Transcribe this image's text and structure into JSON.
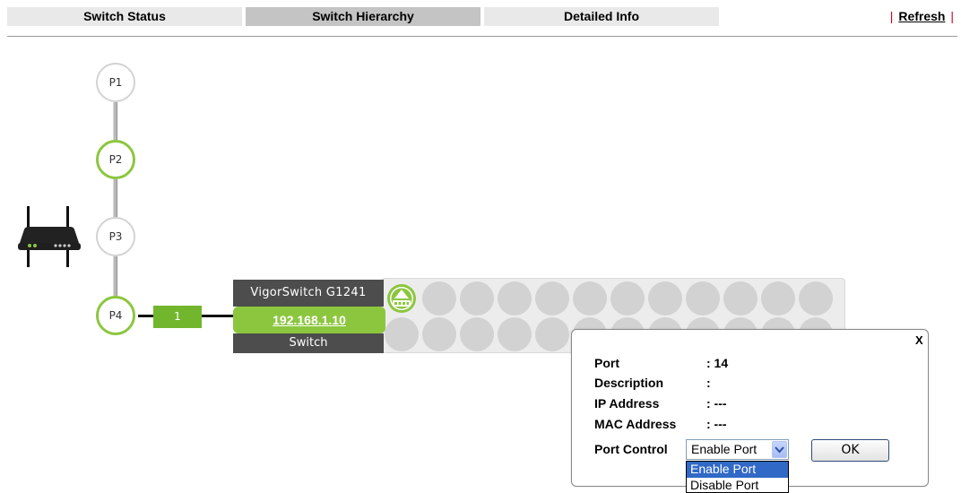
{
  "tabs": [
    {
      "label": "Switch Status",
      "active": false
    },
    {
      "label": "Switch Hierarchy",
      "active": true
    },
    {
      "label": "Detailed Info",
      "active": false
    }
  ],
  "refresh": {
    "pipe": "|",
    "label": "Refresh"
  },
  "topology": {
    "nodes": [
      "P1",
      "P2",
      "P3",
      "P4"
    ],
    "active_nodes": [
      "P2",
      "P4"
    ],
    "port_chip": "1",
    "switch": {
      "model": "VigorSwitch G1241",
      "ip": "192.168.1.10",
      "type": "Switch"
    }
  },
  "popup": {
    "close": "X",
    "fields": [
      {
        "label": "Port",
        "value": ": 14"
      },
      {
        "label": "Description",
        "value": ":"
      },
      {
        "label": "IP Address",
        "value": ": ---"
      },
      {
        "label": "MAC Address",
        "value": ": ---"
      }
    ],
    "port_control": {
      "label": "Port Control",
      "selected": "Enable Port",
      "options": [
        "Enable Port",
        "Disable Port"
      ]
    },
    "ok_label": "OK"
  },
  "colors": {
    "accent_green": "#8cc63f",
    "chip_green": "#72b62e",
    "switch_dark": "#4d4d4d",
    "active_tab": "#c4c4c4",
    "inactive_tab": "#e9e9e9",
    "port_gray": "#d2d2d2",
    "select_highlight": "#3169c6",
    "refresh_pipe": "#d3001c"
  }
}
